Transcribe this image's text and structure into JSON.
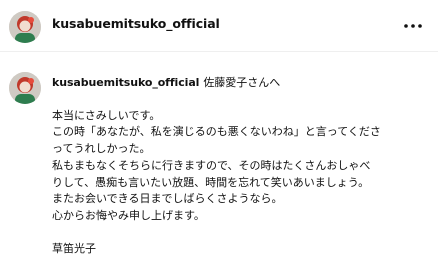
{
  "header": {
    "username": "kusabuemitsuko_official",
    "more_icon": "more-horizontal-icon"
  },
  "comment": {
    "username": "kusabuemitsuko_official",
    "mention": "佐藤愛子さんへ",
    "lines": [
      "本当にさみしいです。",
      "この時「あなたが、私を演じるのも悪くないわね」と言ってくださ",
      "ってうれしかった。",
      "私もまもなくそちらに行きますので、その時はたくさんおしゃべ",
      "りして、愚痴も言いたい放題、時間を忘れて笑いあいましょう。",
      "またお会いできる日までしばらくさようなら。",
      "心からお悔やみ申し上げます。"
    ],
    "signature": "草笛光子"
  }
}
